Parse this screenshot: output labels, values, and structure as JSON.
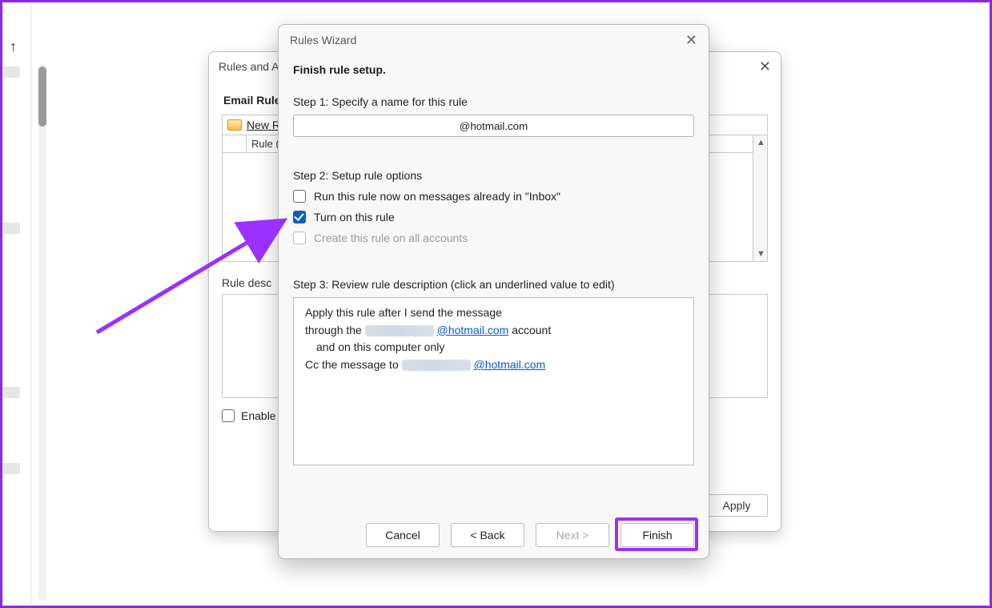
{
  "farLeft": {
    "upGlyph": "↑"
  },
  "rulesDialog": {
    "title": "Rules and A",
    "tab": "Email Rules",
    "newRuleLabel": "New R",
    "gridHeader": "Rule (a",
    "descLabel": "Rule desc",
    "enableLabel": "Enable",
    "applyLabel": "Apply",
    "closeGlyph": "✕"
  },
  "wizard": {
    "title": "Rules Wizard",
    "closeGlyph": "✕",
    "heading": "Finish rule setup.",
    "step1Label": "Step 1: Specify a name for this rule",
    "ruleName": "@hotmail.com",
    "step2Label": "Step 2: Setup rule options",
    "opt_run": "Run this rule now on messages already in \"Inbox\"",
    "opt_turnon": "Turn on this rule",
    "opt_allaccts": "Create this rule on all accounts",
    "step3Label": "Step 3: Review rule description (click an underlined value to edit)",
    "review": {
      "l1": "Apply this rule after I send the message",
      "l2_a": "through the ",
      "l2_link": "@hotmail.com",
      "l2_b": " account",
      "l3": "and on this computer only",
      "l4_a": "Cc the message to ",
      "l4_link": "@hotmail.com"
    },
    "buttons": {
      "cancel": "Cancel",
      "back": "< Back",
      "next": "Next >",
      "finish": "Finish"
    }
  }
}
